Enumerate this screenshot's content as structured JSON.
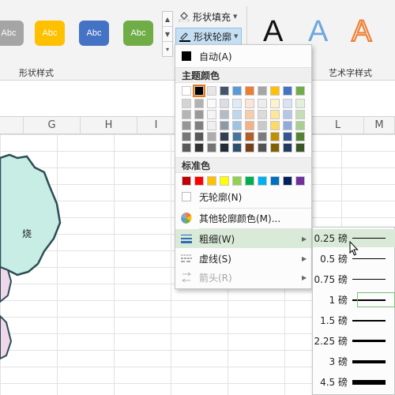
{
  "ribbon": {
    "style_buttons": [
      {
        "label": "Abc",
        "color": "#a5a5a5"
      },
      {
        "label": "Abc",
        "color": "#ffc000"
      },
      {
        "label": "Abc",
        "color": "#4472c4"
      },
      {
        "label": "Abc",
        "color": "#70ad47"
      }
    ],
    "shape_styles_label": "形状样式",
    "shape_fill_label": "形状填充",
    "shape_outline_label": "形状轮廓",
    "wordart_label": "艺术字样式",
    "wordart_letters": [
      "A",
      "A",
      "A"
    ]
  },
  "columns": [
    "G",
    "H",
    "I",
    "L",
    "M"
  ],
  "map_label": "烧",
  "outline_menu": {
    "auto_label": "自动(A)",
    "theme_colors_header": "主题颜色",
    "theme_colors": [
      "#ffffff",
      "#000000",
      "#e7e6e6",
      "#44546a",
      "#5b9bd5",
      "#ed7d31",
      "#a5a5a5",
      "#ffc000",
      "#4472c4",
      "#70ad47"
    ],
    "standard_colors_header": "标准色",
    "standard_colors": [
      "#c00000",
      "#ff0000",
      "#ffc000",
      "#ffff00",
      "#92d050",
      "#00b050",
      "#00b0f0",
      "#0070c0",
      "#002060",
      "#7030a0"
    ],
    "no_outline_label": "无轮廓(N)",
    "more_colors_label": "其他轮廓颜色(M)...",
    "weight_label": "粗细(W)",
    "dashes_label": "虚线(S)",
    "arrows_label": "箭头(R)"
  },
  "weight_menu": {
    "options": [
      {
        "label": "0.25 磅",
        "thickness": 1
      },
      {
        "label": "0.5 磅",
        "thickness": 1
      },
      {
        "label": "0.75 磅",
        "thickness": 1
      },
      {
        "label": "1 磅",
        "thickness": 2
      },
      {
        "label": "1.5 磅",
        "thickness": 2
      },
      {
        "label": "2.25 磅",
        "thickness": 3
      },
      {
        "label": "3 磅",
        "thickness": 4
      },
      {
        "label": "4.5 磅",
        "thickness": 6
      }
    ],
    "hovered_index": 0,
    "current_index": 3
  }
}
